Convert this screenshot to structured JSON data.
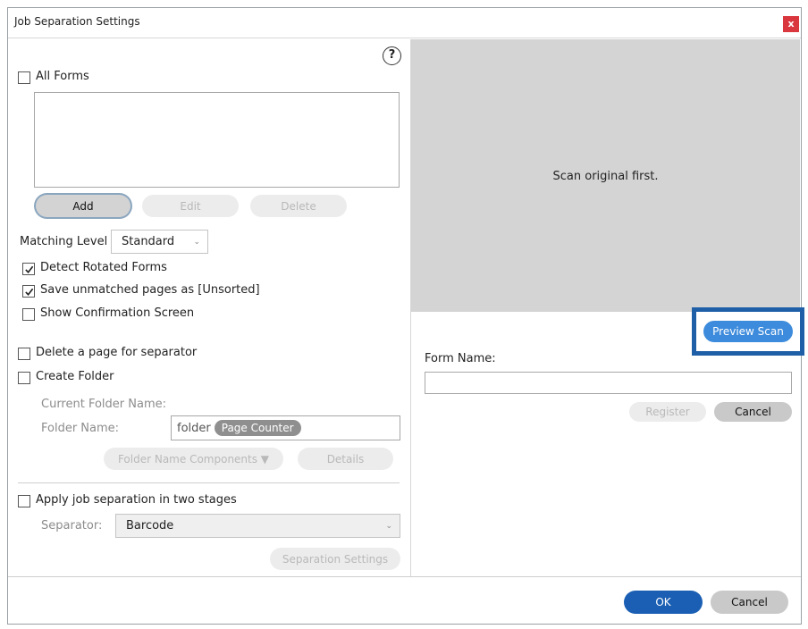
{
  "window": {
    "title": "Job Separation Settings",
    "close_glyph": "x"
  },
  "help": {
    "glyph": "?"
  },
  "forms": {
    "all_forms_label": "All Forms",
    "all_forms_checked": false,
    "buttons": {
      "add": "Add",
      "edit": "Edit",
      "delete": "Delete"
    }
  },
  "matching": {
    "label": "Matching Level",
    "value": "Standard",
    "arrow": "⌄"
  },
  "options": {
    "detect_rotated": {
      "label": "Detect Rotated Forms",
      "checked": true
    },
    "save_unmatched": {
      "label": "Save unmatched pages as [Unsorted]",
      "checked": true
    },
    "show_confirmation": {
      "label": "Show Confirmation Screen",
      "checked": false
    },
    "delete_page": {
      "label": "Delete a page for separator",
      "checked": false
    },
    "create_folder": {
      "label": "Create Folder",
      "checked": false
    }
  },
  "folder": {
    "current_label": "Current Folder Name:",
    "name_label": "Folder Name:",
    "name_prefix": "folder",
    "chip": "Page Counter",
    "components_button": "Folder Name Components ▼",
    "details_button": "Details"
  },
  "two_stage": {
    "label": "Apply job separation in two stages",
    "checked": false,
    "separator_label": "Separator:",
    "separator_value": "Barcode",
    "separator_arrow": "⌄",
    "settings_button": "Separation Settings"
  },
  "preview": {
    "message": "Scan original first.",
    "preview_button": "Preview Scan",
    "form_name_label": "Form Name:",
    "form_name_value": "",
    "register_button": "Register",
    "cancel_button": "Cancel"
  },
  "footer": {
    "ok": "OK",
    "cancel": "Cancel"
  },
  "colors": {
    "primary": "#1a5fb3",
    "highlight": "#1f5fa8",
    "close": "#d9363e",
    "preview_bg": "#d4d4d4"
  }
}
